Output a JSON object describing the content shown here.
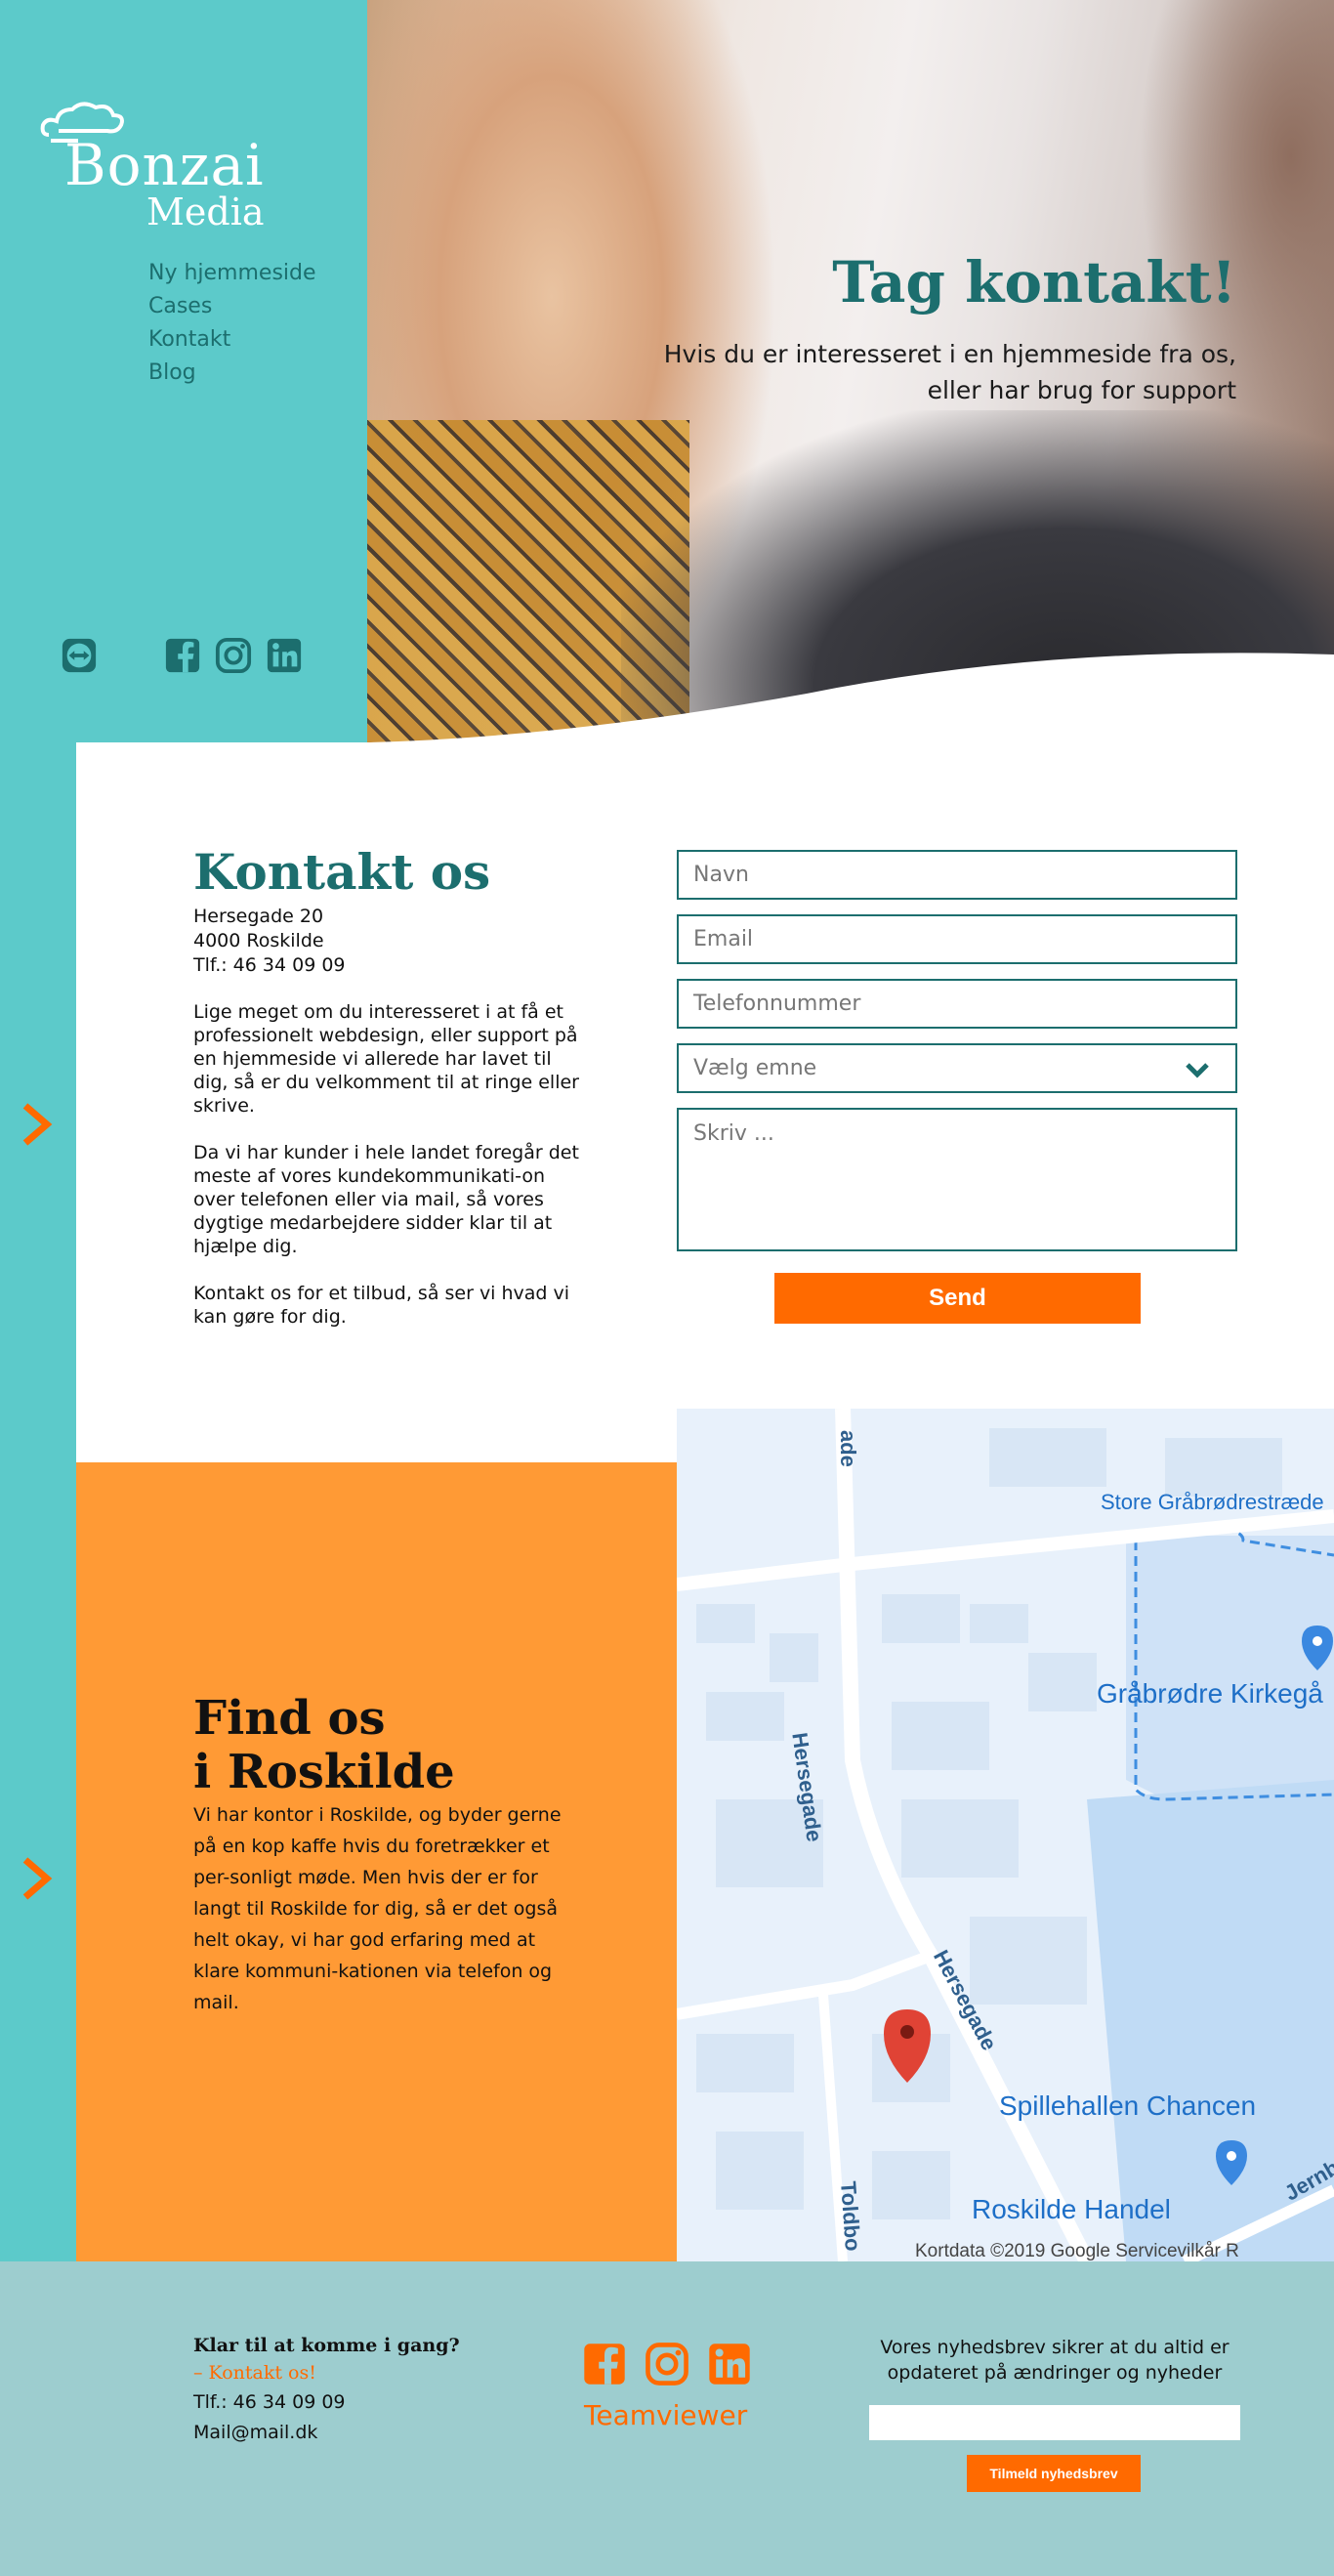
{
  "brand": {
    "name": "Bonzai",
    "sub": "Media"
  },
  "nav": {
    "items": [
      {
        "label": "Ny hjemmeside"
      },
      {
        "label": "Cases"
      },
      {
        "label": "Kontakt"
      },
      {
        "label": "Blog"
      }
    ]
  },
  "social_icons": [
    "teamviewer-icon",
    "facebook-icon",
    "instagram-icon",
    "linkedin-icon"
  ],
  "hero": {
    "title": "Tag kontakt!",
    "subtitle_line1": "Hvis du er interesseret i en hjemmeside fra os,",
    "subtitle_line2": "eller har brug for support"
  },
  "contact": {
    "title": "Kontakt os",
    "address_line1": "Hersegade 20",
    "address_line2": "4000 Roskilde",
    "phone": "Tlf.: 46 34 09 09",
    "para1": "Lige meget om du interesseret i at få et professionelt webdesign, eller support på en hjemmeside vi allerede har lavet til dig, så er du velkomment til at ringe eller skrive.",
    "para2": "Da vi har kunder i hele landet foregår det meste af vores kundekommunikati-on over telefonen eller via mail, så vores dygtige medarbejdere sidder klar til at hjælpe dig.",
    "para3": "Kontakt os for et tilbud, så ser vi hvad vi kan gøre for dig."
  },
  "form": {
    "name_placeholder": "Navn",
    "email_placeholder": "Email",
    "phone_placeholder": "Telefonnummer",
    "topic_selected": "Vælg emne",
    "message_placeholder": "Skriv ...",
    "send_label": "Send"
  },
  "find": {
    "title_line1": "Find os",
    "title_line2": "i Roskilde",
    "text": "Vi har kontor i Roskilde, og byder gerne på en kop kaffe hvis du foretrækker et per-sonligt møde. Men hvis der er for langt til Roskilde for dig, så er det også helt okay, vi har god erfaring med at klare kommuni-kationen via telefon og mail."
  },
  "map": {
    "street_top": "Store Gråbrødrestræde",
    "church": "Gråbrødre Kirkegå",
    "road1": "Hersegade",
    "road2": "Hersegade",
    "road_top": "ade",
    "hall": "Spillehallen Chancen",
    "shop": "Roskilde Handel",
    "road3": "Jernb",
    "road4": "Toldbo",
    "attribution": "Kortdata ©2019 Google    Servicevilkår    R"
  },
  "footer": {
    "title": "Klar til at komme i gang?",
    "cta": "– Kontakt os!",
    "phone": "Tlf.: 46 34 09 09",
    "mail": "Mail@mail.dk",
    "teamviewer": "Teamviewer",
    "newsletter_line1": "Vores nyhedsbrev sikrer at du altid er",
    "newsletter_line2": "opdateret på ændringer og nyheder",
    "newsletter_button": "Tilmeld nyhedsbrev"
  },
  "colors": {
    "teal": "#5ccaca",
    "dark_teal": "#1c6e6e",
    "orange": "#ff6a00",
    "light_orange": "#ff9a35",
    "footer_bg": "#9dcdcf"
  }
}
